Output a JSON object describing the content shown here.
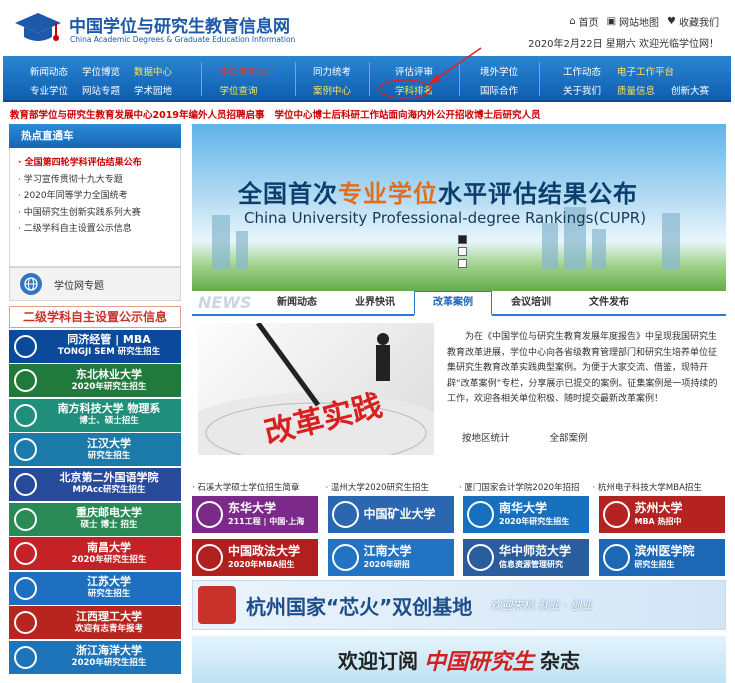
{
  "header": {
    "site_name": "中国学位与研究生教育信息网",
    "site_name_en": "China Academic Degrees & Graduate Education Information",
    "links": [
      "首页",
      "网站地图",
      "收藏我们"
    ],
    "date_line": "2020年2月22日  星期六   欢迎光临学位网！"
  },
  "nav": {
    "groups": [
      [
        "新闻动态",
        "学位博览",
        "数据中心",
        "专业学位",
        "网站专题",
        "学术园地"
      ],
      [
        "中国学位认证",
        "学位查询"
      ],
      [
        "同力统考",
        "案例中心"
      ],
      [
        "评估评审",
        "学科排名"
      ],
      [
        "境外学位",
        "国际合作"
      ],
      [
        "工作动态",
        "电子工作平台",
        "关于我们",
        "质量信息",
        "创新大赛"
      ]
    ]
  },
  "news_ticker": [
    "教育部学位与研究生教育发展中心2019年编外人员招聘启事",
    "学位中心博士后科研工作站面向海内外公开招收博士后研究人员"
  ],
  "sidebar": {
    "hot_title": "热点直通车",
    "hot_items": [
      "全国第四轮学科评估结果公布",
      "学习宣传贯彻十九大专题",
      "2020年同等学力全国统考",
      "中国研究生创新实践系列大赛",
      "二级学科自主设置公示信息"
    ],
    "topic_label": "学位网专题",
    "gongshi": "二级学科自主设置公示信息",
    "ads": [
      {
        "name": "同济经管 | MBA",
        "sub": "TONGJI SEM  研究生招生",
        "color": "#0b4a9a"
      },
      {
        "name": "东北林业大学",
        "sub": "2020年研究生招生",
        "color": "#1f7a3c"
      },
      {
        "name": "南方科技大学 物理系",
        "sub": "博士、硕士招生",
        "color": "#1f8f7c"
      },
      {
        "name": "江汉大学",
        "sub": "研究生招生",
        "color": "#1c7aa8"
      },
      {
        "name": "北京第二外国语学院",
        "sub": "MPAcc研究生招生",
        "color": "#284a9a"
      },
      {
        "name": "重庆邮电大学",
        "sub": "硕士 博士 招生",
        "color": "#2a8a55"
      },
      {
        "name": "南昌大学",
        "sub": "2020年研究生招生",
        "color": "#c42226"
      },
      {
        "name": "江苏大学",
        "sub": "研究生招生",
        "color": "#1e6fbf"
      },
      {
        "name": "江西理工大学",
        "sub": "欢迎有志青年报考",
        "color": "#b8251f"
      },
      {
        "name": "浙江海洋大学",
        "sub": "2020年研究生招生",
        "color": "#1d74b8"
      }
    ]
  },
  "banner": {
    "title_pre": "全国首次",
    "title_highlight": "专业学位",
    "title_post": "水平评估结果公布",
    "subtitle": "China University Professional-degree Rankings(CUPR)"
  },
  "tabs": {
    "news_word": "NEWS",
    "items": [
      "新闻动态",
      "业界快讯",
      "改革案例",
      "会议培训",
      "文件发布"
    ],
    "active_index": 2
  },
  "case": {
    "image_text": "改革实践",
    "text": "为在《中国学位与研究生教育发展年度报告》中呈现我国研究生教育改革进展，学位中心向各省级教育管理部门和研究生培养单位征集研究生教育改革实践典型案例。为便于大家交流、借鉴，现特开辟“改革案例”专栏，分享展示已提交的案例。征集案例是一项持续的工作，欢迎各相关单位积极、随时提交最新改革案例！",
    "links": [
      "按地区统计",
      "全部案例"
    ]
  },
  "schools_text": [
    "· 石溪大学硕士学位招生简章",
    "· 温州大学2020研究生招生",
    "· 厦门国家会计学院2020年招招",
    "· 杭州电子科技大学MBA招生"
  ],
  "school_logos": [
    {
      "name": "东华大学",
      "sub": "211工程 | 中国·上海",
      "color": "#7b2a8a"
    },
    {
      "name": "中国矿业大学",
      "sub": "",
      "color": "#2b66b0"
    },
    {
      "name": "南华大学",
      "sub": "2020年研究生招生",
      "color": "#1770bd"
    },
    {
      "name": "苏州大学",
      "sub": "MBA 热招中",
      "color": "#b52222"
    },
    {
      "name": "中国政法大学",
      "sub": "2020年MBA招生",
      "color": "#b1201e"
    },
    {
      "name": "江南大学",
      "sub": "2020年研招",
      "color": "#2274c3"
    },
    {
      "name": "华中师范大学",
      "sub": "信息资源管理研究",
      "color": "#2a5d9e"
    },
    {
      "name": "滨州医学院",
      "sub": "研究生招生",
      "color": "#1c68b6"
    }
  ],
  "hangzhou": {
    "title": "杭州国家“芯火”双创基地",
    "slogan": "欢迎来杭 就业 · 创业"
  },
  "subscribe": {
    "text": "欢迎订阅",
    "magazine": "中国研究生",
    "suffix": "杂志"
  },
  "colors": {
    "nav_blue": "#1666b4",
    "news_red": "#c00",
    "brand_blue": "#1e58a8"
  }
}
